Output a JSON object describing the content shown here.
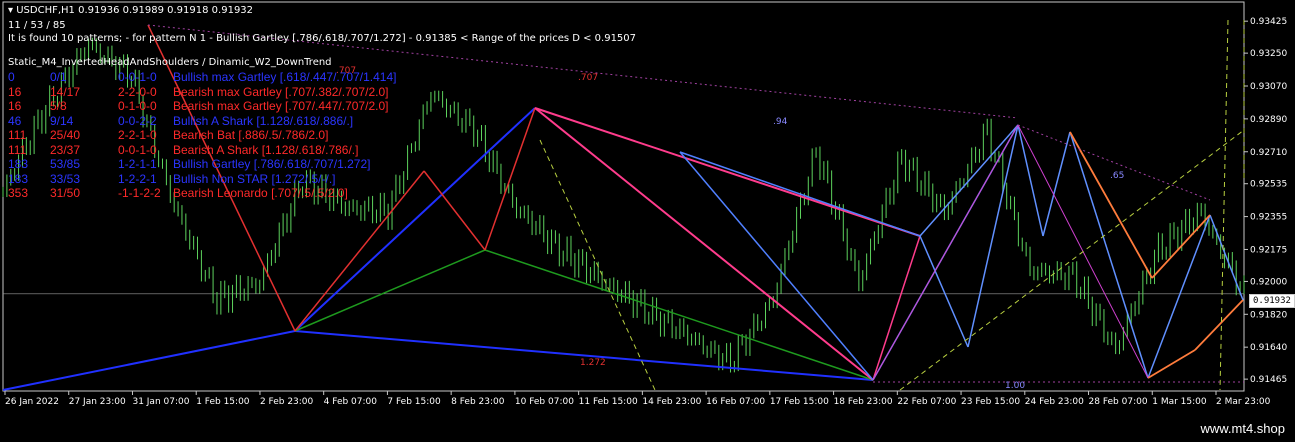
{
  "header": {
    "symbol_line": "USDCHF,H1  0.91936 0.91989 0.91918 0.91932",
    "counter_line": "11 / 53 / 85",
    "found_line": "It is found 10 patterns;  -  for pattern N 1 - Bullish Gartley [.786/.618/.707/1.272] - 0.91385 < Range of the prices D < 0.91507",
    "static_line": "Static_M4_InvertedHeadAndShoulders  /  Dinamic_W2_DownTrend"
  },
  "patterns": [
    {
      "count": "0",
      "ratio": "0/1",
      "code": "0-0-1-0",
      "name": "Bullish max Gartley [.618/.447/.707/1.414]",
      "color": "#2b35ff"
    },
    {
      "count": "16",
      "ratio": "14/17",
      "code": "2-2-0-0",
      "name": "Bearish max Gartley [.707/.382/.707/2.0]",
      "color": "#ff2a2a"
    },
    {
      "count": "16",
      "ratio": "5/8",
      "code": "0-1-0-0",
      "name": "Bearish max Gartley [.707/.447/.707/2.0]",
      "color": "#ff2a2a"
    },
    {
      "count": "46",
      "ratio": "9/14",
      "code": "0-0-2-2",
      "name": "Bullish A Shark [1.128/.618/.886/.]",
      "color": "#2b35ff"
    },
    {
      "count": "111",
      "ratio": "25/40",
      "code": "2-2-1-0",
      "name": "Bearish Bat [.886/.5/.786/2.0]",
      "color": "#ff2a2a"
    },
    {
      "count": "111",
      "ratio": "23/37",
      "code": "0-0-1-0",
      "name": "Bearish A Shark [1.128/.618/.786/.]",
      "color": "#ff2a2a"
    },
    {
      "count": "183",
      "ratio": "53/85",
      "code": "1-2-1-1",
      "name": "Bullish Gartley [.786/.618/.707/1.272]",
      "color": "#2b35ff"
    },
    {
      "count": "183",
      "ratio": "33/53",
      "code": "1-2-2-1",
      "name": "Bullish Non STAR [1.272/.5/-/.]",
      "color": "#2b35ff"
    },
    {
      "count": "353",
      "ratio": "31/50",
      "code": "-1-1-2-2",
      "name": "Bearish Leonardo [.707/.5/.5/2.0]",
      "color": "#ff2a2a"
    }
  ],
  "current_price": "0.91932",
  "watermark": "www.mt4.shop",
  "chart_data": {
    "type": "line",
    "title": "USDCHF,H1",
    "ylim": [
      0.914,
      0.9353
    ],
    "y_ticks": [
      "0.93425",
      "0.93250",
      "0.93070",
      "0.92890",
      "0.92710",
      "0.92535",
      "0.92355",
      "0.92175",
      "0.92000",
      "0.91820",
      "0.91640",
      "0.91465"
    ],
    "x_ticks": [
      "26 Jan 2022",
      "27 Jan 23:00",
      "31 Jan 07:00",
      "1 Feb 15:00",
      "2 Feb 23:00",
      "4 Feb 07:00",
      "7 Feb 15:00",
      "8 Feb 23:00",
      "10 Feb 07:00",
      "11 Feb 15:00",
      "14 Feb 23:00",
      "16 Feb 07:00",
      "17 Feb 15:00",
      "18 Feb 23:00",
      "22 Feb 07:00",
      "23 Feb 15:00",
      "24 Feb 23:00",
      "28 Feb 07:00",
      "1 Mar 15:00",
      "2 Mar 23:00"
    ],
    "series": [
      {
        "values": [
          [
            0,
            0.925
          ],
          [
            1,
            0.9295
          ],
          [
            2,
            0.933
          ],
          [
            3,
            0.9312
          ],
          [
            4,
            0.9241
          ],
          [
            5,
            0.919
          ],
          [
            6,
            0.92
          ],
          [
            7,
            0.9256
          ],
          [
            8,
            0.9241
          ],
          [
            9,
            0.9238
          ],
          [
            10,
            0.9302
          ],
          [
            11,
            0.9283
          ],
          [
            12,
            0.924
          ],
          [
            13,
            0.9218
          ],
          [
            14,
            0.9201
          ],
          [
            15,
            0.9185
          ],
          [
            16,
            0.917
          ],
          [
            17,
            0.9155
          ],
          [
            18,
            0.919
          ],
          [
            19,
            0.9272
          ],
          [
            20,
            0.92
          ],
          [
            21,
            0.9268
          ],
          [
            22,
            0.9238
          ],
          [
            23,
            0.9282
          ],
          [
            24,
            0.9205
          ],
          [
            25,
            0.9203
          ],
          [
            26,
            0.9163
          ],
          [
            27,
            0.9218
          ],
          [
            28,
            0.9238
          ],
          [
            29,
            0.9193
          ]
        ]
      }
    ],
    "annotations": [
      ".707",
      ".707",
      ".94",
      ".65",
      "1.272",
      "1.00"
    ]
  }
}
